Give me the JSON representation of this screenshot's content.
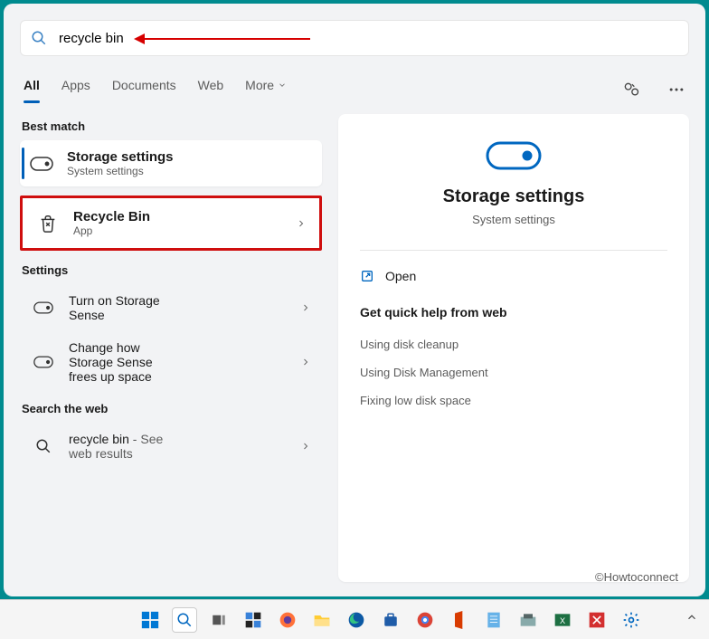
{
  "search": {
    "value": "recycle bin"
  },
  "tabs": {
    "all": "All",
    "apps": "Apps",
    "documents": "Documents",
    "web": "Web",
    "more": "More"
  },
  "sections": {
    "best_match": "Best match",
    "settings": "Settings",
    "search_web": "Search the web"
  },
  "results": {
    "storage": {
      "title": "Storage settings",
      "sub": "System settings"
    },
    "recycle": {
      "title": "Recycle Bin",
      "sub": "App"
    }
  },
  "settings_items": [
    {
      "title": "Turn on Storage Sense"
    },
    {
      "title": "Change how Storage Sense frees up space"
    }
  ],
  "web_item": {
    "title": "recycle bin",
    "suffix": " - See web results"
  },
  "detail": {
    "title": "Storage settings",
    "sub": "System settings",
    "open": "Open",
    "quick_title": "Get quick help from web",
    "quick_links": [
      "Using disk cleanup",
      "Using Disk Management",
      "Fixing low disk space"
    ]
  },
  "watermark": "©Howtoconnect"
}
